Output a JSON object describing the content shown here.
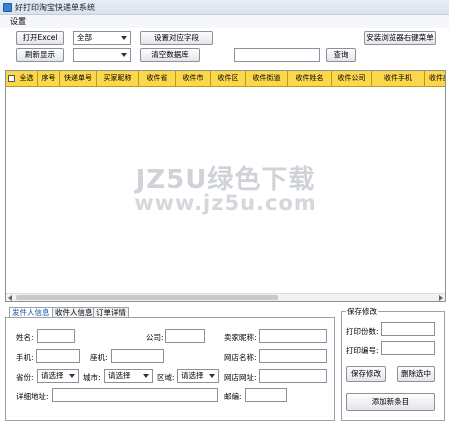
{
  "window": {
    "title": "好打印淘宝快递单系统"
  },
  "menu": {
    "settings": "设置"
  },
  "toolbar": {
    "open_excel": "打开Excel",
    "filter_select": "全部",
    "set_fields": "设置对应字段",
    "install_menu": "安装浏览器右键菜单",
    "refresh": "刷新显示",
    "second_select": "",
    "clear_db": "清空数据库",
    "search_value": "",
    "query": "查询"
  },
  "table": {
    "columns": [
      "全选",
      "序号",
      "快递单号",
      "买家昵称",
      "收件省",
      "收件市",
      "收件区",
      "收件街道",
      "收件姓名",
      "收件公司",
      "收件手机",
      "收件座"
    ]
  },
  "watermark": {
    "line1": "JZ5U绿色下载",
    "line2": "www.jz5u.com"
  },
  "tabs": {
    "sender": "发件人信息",
    "receiver": "收件人信息",
    "order": "订单详情"
  },
  "form": {
    "name": "姓名:",
    "company": "公司:",
    "buyer_nick": "卖家昵称:",
    "phone": "手机:",
    "landline": "座机:",
    "shop_name": "网店名称:",
    "province": "省份:",
    "province_value": "请选择",
    "city": "城市:",
    "city_value": "请选择",
    "district": "区域:",
    "district_value": "请选择",
    "shop_url": "网店网址:",
    "address": "详细地址:",
    "postcode": "邮编:"
  },
  "save_group": {
    "legend": "保存修改",
    "print_count": "打印份数:",
    "print_number": "打印编号:",
    "save": "保存修改",
    "delete": "删除选中",
    "add": "添加新条目"
  }
}
